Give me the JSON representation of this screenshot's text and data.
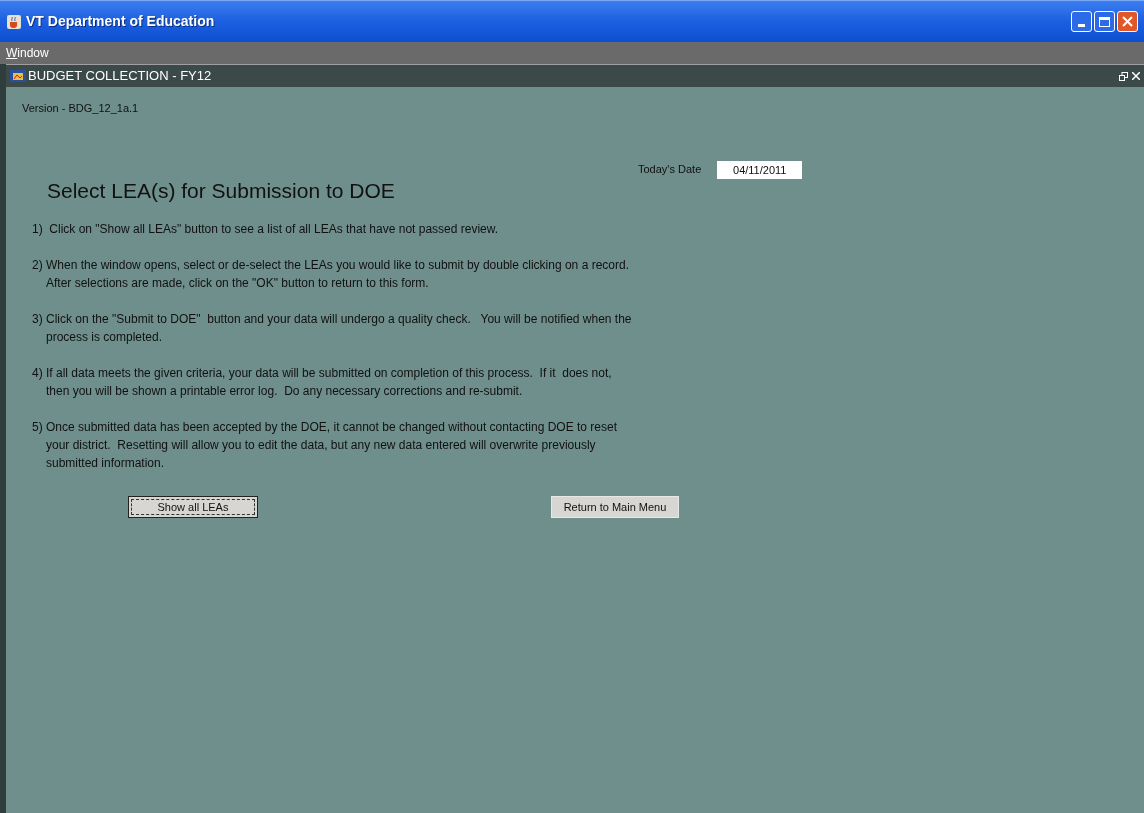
{
  "window": {
    "title": "VT Department of Education"
  },
  "menu_bar": [
    {
      "label": "Window"
    }
  ],
  "inner_frame": {
    "title": "BUDGET COLLECTION - FY12"
  },
  "version": "Version - BDG_12_1a.1",
  "date": {
    "label": "Today's Date",
    "value": "04/11/2011"
  },
  "heading": "Select LEA(s) for Submission to DOE",
  "instructions": [
    {
      "lines": [
        "1)  Click on \"Show all LEAs\" button to see a list of all LEAs that have not passed review."
      ]
    },
    {
      "lines": [
        "2) When the window opens, select or de-select the LEAs you would like to submit by double clicking on a record.",
        "After selections are made, click on the \"OK\" button to return to this form."
      ]
    },
    {
      "lines": [
        "3) Click on the \"Submit to DOE\"  button and your data will undergo a quality check.   You will be notified when the",
        "process is completed."
      ]
    },
    {
      "lines": [
        "4) If all data meets the given criteria, your data will be submitted on completion of this process.  If it  does not,",
        "then you will be shown a printable error log.  Do any necessary corrections and re-submit."
      ]
    },
    {
      "lines": [
        "5) Once submitted data has been accepted by the DOE, it cannot be changed without contacting DOE to reset",
        "your district.  Resetting will allow you to edit the data, but any new data entered will overwrite previously",
        "submitted information."
      ]
    }
  ],
  "buttons": [
    {
      "label": "Show all LEAs",
      "focused": true
    },
    {
      "label": "Return to Main Menu",
      "focused": false
    }
  ]
}
